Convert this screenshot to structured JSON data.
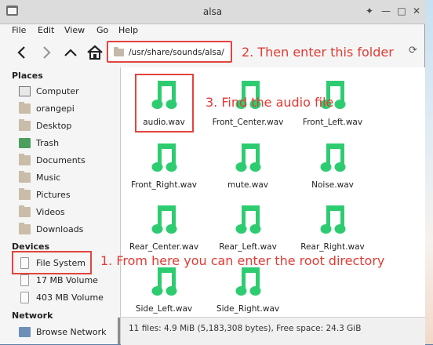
{
  "window": {
    "title": "alsa"
  },
  "menu": [
    "File",
    "Edit",
    "View",
    "Go",
    "Help"
  ],
  "toolbar": {
    "path": "/usr/share/sounds/alsa/",
    "refresh_icon": "refresh-icon"
  },
  "sidebar": {
    "places_heading": "Places",
    "places": [
      {
        "label": "Computer",
        "icon": "computer-icon"
      },
      {
        "label": "orangepi",
        "icon": "home-folder-icon"
      },
      {
        "label": "Desktop",
        "icon": "folder-icon"
      },
      {
        "label": "Trash",
        "icon": "trash-icon"
      },
      {
        "label": "Documents",
        "icon": "folder-icon"
      },
      {
        "label": "Music",
        "icon": "folder-icon"
      },
      {
        "label": "Pictures",
        "icon": "folder-icon"
      },
      {
        "label": "Videos",
        "icon": "folder-icon"
      },
      {
        "label": "Downloads",
        "icon": "folder-icon"
      }
    ],
    "devices_heading": "Devices",
    "devices": [
      {
        "label": "File System",
        "icon": "drive-icon"
      },
      {
        "label": "17 MB Volume",
        "icon": "drive-icon"
      },
      {
        "label": "403 MB Volume",
        "icon": "drive-icon"
      }
    ],
    "network_heading": "Network",
    "network": [
      {
        "label": "Browse Network",
        "icon": "network-icon"
      }
    ]
  },
  "files": [
    "audio.wav",
    "Front_Center.wav",
    "Front_Left.wav",
    "Front_Right.wav",
    "mute.wav",
    "Noise.wav",
    "Rear_Center.wav",
    "Rear_Left.wav",
    "Rear_Right.wav",
    "Side_Left.wav",
    "Side_Right.wav"
  ],
  "annotations": {
    "step1": "1. From here you can enter the root directory",
    "step2": "2. Then enter this folder",
    "step3": "3. Find the audio file"
  },
  "status": "11 files: 4.9 MiB (5,183,308 bytes), Free space: 24.3 GiB",
  "colors": {
    "annotation": "#e23b34",
    "file_icon": "#2ecc71",
    "highlight_box": "#e2443e"
  }
}
